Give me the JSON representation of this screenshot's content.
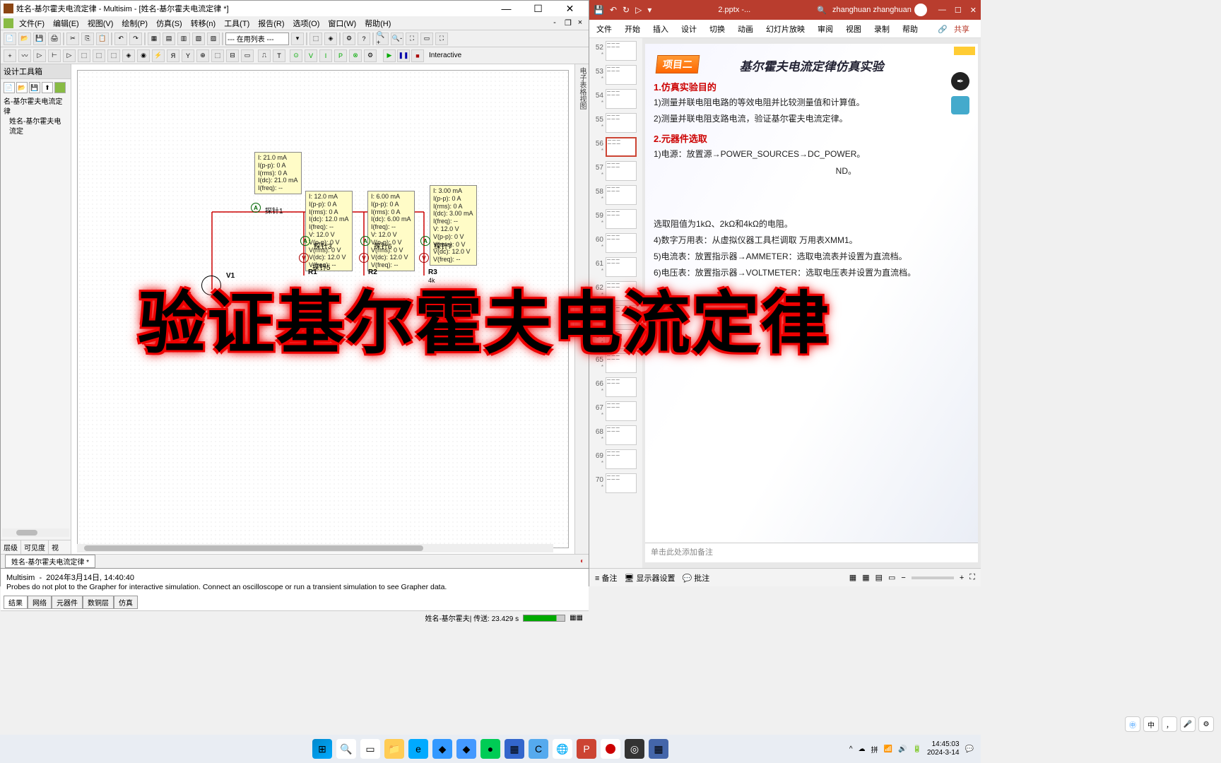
{
  "multisim": {
    "title": "姓名-基尔霍夫电流定律 - Multisim - [姓名-基尔霍夫电流定律 *]",
    "menus": [
      "文件(F)",
      "编辑(E)",
      "视图(V)",
      "绘制(P)",
      "仿真(S)",
      "转移(n)",
      "工具(T)",
      "报告(R)",
      "选项(O)",
      "窗口(W)",
      "帮助(H)"
    ],
    "combo": "--- 在用列表 ---",
    "sim_label": "Interactive",
    "left_title": "设计工具箱",
    "left_items": [
      "名-基尔霍夫电流定律",
      "姓名-基尔霍夫电流定"
    ],
    "tab_name": "姓名-基尔霍夫电流定律 *",
    "bottom_left": [
      "层级",
      "可见度",
      "视"
    ],
    "log_time": "2024年3月14日, 14:40:40",
    "log_app": "Multisim",
    "log_msg": "Probes do not plot to the Grapher for interactive simulation. Connect an oscilloscope or run a transient simulation to see Grapher data.",
    "log_tabs": [
      "结果",
      "网络",
      "元器件",
      "数铜层",
      "仿真"
    ],
    "side_text": "电子表格视图",
    "status_file": "姓名-基尔霍夫| 传送: 23.429 s",
    "probes": {
      "p1_label": "探针1",
      "p1": "I: 21.0 mA\nI(p-p): 0 A\nI(rms): 0 A\nI(dc): 21.0 mA\nI(freq): --",
      "p2_label": "探针3",
      "p2": "I: 12.0 mA\nI(p-p): 0 A\nI(rms): 0 A\nI(dc): 12.0 mA\nI(freq): --\nV: 12.0 V\nV(p-p): 0 V\nV(rms): 0 V\nV(dc): 12.0 V\nV(freq): --",
      "p3_label": "探针6",
      "p3": "I: 6.00 mA\nI(p-p): 0 A\nI(rms): 0 A\nI(dc): 6.00 mA\nI(freq): --\nV: 12.0 V\nV(p-p): 0 V\nV(rms): 0 V\nV(dc): 12.0 V\nV(freq): --",
      "p4_label": "探针7",
      "p4": "I: 3.00 mA\nI(p-p): 0 A\nI(rms): 0 A\nI(dc): 3.00 mA\nI(freq): --\nV: 12.0 V\nV(p-p): 0 V\nV(rms): 0 V\nV(dc): 12.0 V\nV(freq): --",
      "p5_label": "探针5"
    },
    "components": {
      "v1": "V1",
      "r1": "R1",
      "r2": "R2",
      "r3": "R3",
      "r3v": "4k"
    }
  },
  "overlay": "验证基尔霍夫电流定律",
  "ppt": {
    "docname": "2.pptx -...",
    "user": "zhanghuan zhanghuan",
    "ribbon": [
      "文件",
      "开始",
      "插入",
      "设计",
      "切换",
      "动画",
      "幻灯片放映",
      "审阅",
      "视图",
      "录制",
      "帮助"
    ],
    "share": "共享",
    "thumbs": [
      52,
      53,
      54,
      55,
      56,
      57,
      58,
      59,
      60,
      61,
      62,
      63,
      64,
      65,
      66,
      67,
      68,
      69,
      70
    ],
    "active_thumb": 56,
    "slide": {
      "badge": "项目二",
      "title": "基尔霍夫电流定律仿真实验",
      "sec1": "1.仿真实验目的",
      "i1": "1)测量并联电阻电路的等效电阻并比较测量值和计算值。",
      "i2": "2)测量并联电阻支路电流，验证基尔霍夫电流定律。",
      "sec2": "2.元器件选取",
      "i3": "1)电源：放置源→POWER_SOURCES→DC_POWER。",
      "i4_tail": "ND。",
      "i5": "选取阻值为1kΩ、2kΩ和4kΩ的电阻。",
      "i6": "4)数字万用表：从虚拟仪器工具栏调取 万用表XMM1。",
      "i7": "5)电流表：放置指示器→AMMETER：选取电流表并设置为直流档。",
      "i8": "6)电压表：放置指示器→VOLTMETER：选取电压表并设置为直流档。"
    },
    "notes_placeholder": "单击此处添加备注",
    "status": {
      "notes": "备注",
      "display": "显示器设置",
      "comments": "批注"
    }
  },
  "taskbar": {
    "time": "14:45:03",
    "date": "2024-3-14"
  }
}
